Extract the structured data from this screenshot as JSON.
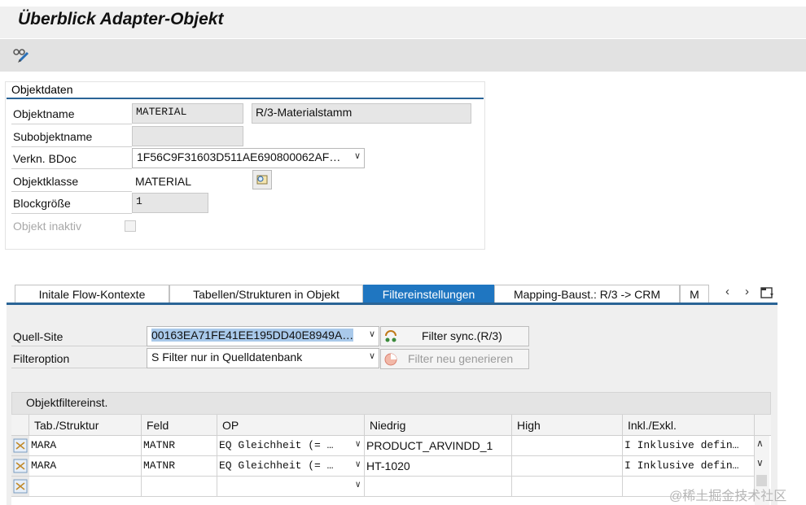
{
  "header": {
    "title": "Überblick Adapter-Objekt"
  },
  "toolbar": {
    "icon": "glasses-pencil-icon"
  },
  "objektdaten": {
    "section_title": "Objektdaten",
    "objektname_label": "Objektname",
    "objektname_value": "MATERIAL",
    "objektname_desc": "R/3-Materialstamm",
    "subobjektname_label": "Subobjektname",
    "subobjektname_value": "",
    "verkn_bdoc_label": "Verkn. BDoc",
    "verkn_bdoc_value": "1F56C9F31603D511AE690800062AF…",
    "objektklasse_label": "Objektklasse",
    "objektklasse_value": "MATERIAL",
    "blockgroesse_label": "Blockgröße",
    "blockgroesse_value": "1",
    "objekt_inaktiv_label": "Objekt inaktiv"
  },
  "tabs": [
    {
      "label": "Initale Flow-Kontexte"
    },
    {
      "label": "Tabellen/Strukturen in Objekt"
    },
    {
      "label": "Filtereinstellungen"
    },
    {
      "label": "Mapping-Baust.: R/3 -> CRM"
    },
    {
      "label": "M"
    }
  ],
  "filter": {
    "quell_site_label": "Quell-Site",
    "quell_site_value": "00163EA71FE41EE195DD40E8949A…",
    "filteroption_label": "Filteroption",
    "filteroption_value": "S Filter nur in Quelldatenbank",
    "filter_sync_label": "Filter sync.(R/3)",
    "filter_neu_label": "Filter neu generieren"
  },
  "table": {
    "title": "Objektfiltereinst.",
    "columns": [
      "Tab./Struktur",
      "Feld",
      "OP",
      "Niedrig",
      "High",
      "Inkl./Exkl."
    ],
    "rows": [
      [
        "MARA",
        "MATNR",
        "EQ Gleichheit (= …",
        "PRODUCT_ARVINDD_1",
        "",
        "I Inklusive defin…"
      ],
      [
        "MARA",
        "MATNR",
        "EQ Gleichheit (= …",
        "HT-1020",
        "",
        "I Inklusive defin…"
      ],
      [
        "",
        "",
        "",
        "",
        "",
        ""
      ]
    ]
  },
  "watermark": "@稀土掘金技术社区",
  "colors": {
    "accent": "#1f76c1",
    "underline": "#2a6496"
  }
}
